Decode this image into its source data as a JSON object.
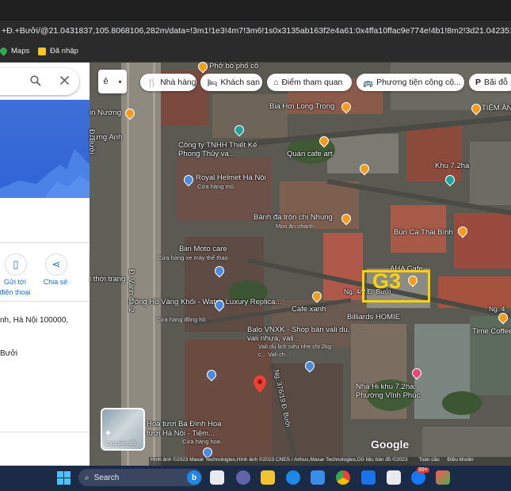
{
  "browser": {
    "url": "+Đ.+Bưởi/@21.0431837,105.8068106,282m/data=!3m1!1e3!4m7!3m6!1s0x3135ab163f2e4a61:0x4ffa10ffac9e774e!4b1!8m2!3d21.0423517!4d105.8",
    "bookmarks": [
      {
        "label": "Maps",
        "icon": "maps-icon",
        "color": "#34a853"
      },
      {
        "label": "Đã nhập",
        "icon": "folder-icon",
        "color": "#f4c430"
      }
    ]
  },
  "panel": {
    "actions": [
      {
        "label": "Gửi tới điện thoại",
        "icon": "send-to-phone-icon"
      },
      {
        "label": "Chia sẻ",
        "icon": "share-icon"
      }
    ],
    "address_line": "nh, Hà Nội 100000,",
    "street_line": "Bưởi",
    "collapse_icon": "chevron-left-icon"
  },
  "map": {
    "lang_button": "ê",
    "chips": [
      {
        "label": "Nhà hàng",
        "icon": "restaurant-icon"
      },
      {
        "label": "Khách sạn",
        "icon": "hotel-icon"
      },
      {
        "label": "Điểm tham quan",
        "icon": "attraction-icon"
      },
      {
        "label": "Phương tiện công cộ...",
        "icon": "transit-icon"
      },
      {
        "label": "Bãi đỗ",
        "icon": "parking-icon"
      }
    ],
    "places": [
      {
        "name": "Phở bò phố cổ",
        "pin": "orange"
      },
      {
        "name": "in Nướng",
        "pin": "orange"
      },
      {
        "name": "hưng Anh",
        "pin": "none"
      },
      {
        "name": "Bia Hơi Long Trọng",
        "pin": "orange"
      },
      {
        "name": "TIỆM ĂN",
        "pin": "orange"
      },
      {
        "name": "Công ty TNHH Thiết Kế Phong Thủy va...",
        "pin": "teal"
      },
      {
        "name": "Quán cafe art",
        "pin": "orange"
      },
      {
        "name": "Khu 7.2ha",
        "pin": "teal"
      },
      {
        "name": "Royal Helmet Hà Nội",
        "sub": "Cửa hàng mũ",
        "pin": "blue"
      },
      {
        "name": "Bánh đa trộn chị Nhung",
        "sub": "Món ăn nhanh",
        "pin": "orange"
      },
      {
        "name": "Bún Cá Thái Bình",
        "pin": "orange"
      },
      {
        "name": "Biin Moto care",
        "sub": "Cửa hàng xe máy thể thao",
        "pin": "blue"
      },
      {
        "name": "AHA Cafe",
        "pin": "orange"
      },
      {
        "name": "i thời trang",
        "pin": "none"
      },
      {
        "name": "Đồng Hồ Vàng Khối - Watch Luxury Replica...",
        "sub": "Cửa hàng đồng hồ",
        "pin": "blue"
      },
      {
        "name": "Cafe xanh",
        "pin": "orange"
      },
      {
        "name": "Billiards HOMIE",
        "pin": "orange"
      },
      {
        "name": "Time Coffee",
        "pin": "orange"
      },
      {
        "name": "Balo VNXK - Shop bán vali du, vali nhựa, vali...",
        "sub": "Vali du lịch siêu nhẹ chỉ 2kg c... Vali ch...",
        "pin": "blue"
      },
      {
        "name": "Nhà Hi khu 7.2ha, Phường Vĩnh Phúc",
        "pin": "pink"
      },
      {
        "name": "Hoa tươi Ba Đình Hoa tươi Hà Nội - Tiệm...",
        "sub": "Cửa hàng hoa",
        "pin": "blue"
      }
    ],
    "streets": [
      "Đ. Bưởi",
      "Đ. Vành đai 2",
      "Ng. 4/2 Đ. Bưởi",
      "Ng. 376/19 Đ. Bưởi",
      "Ng. 4"
    ],
    "annotation": "G3",
    "layer_button": "Lớp bản đồ",
    "google": "Google",
    "attribution": "Hình ảnh ©2023 Maxar Technologies,Hình ảnh ©2023 CNES / Airbus,Maxar Technologies,Dữ liệu bản đồ ©2023",
    "attribution_links": [
      "Toàn cầu",
      "Điều khoản"
    ]
  },
  "taskbar": {
    "search_label": "Search",
    "badge": "99+"
  }
}
